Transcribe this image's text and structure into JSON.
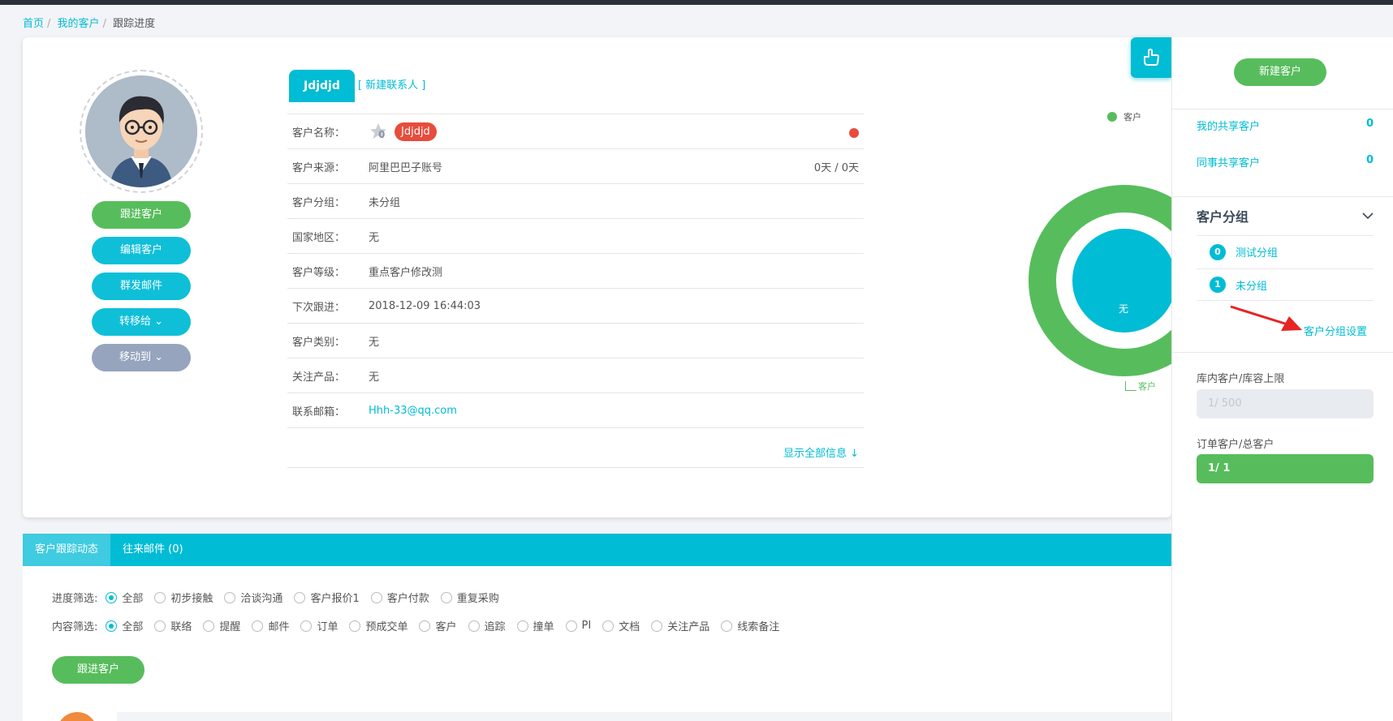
{
  "breadcrumb": {
    "home": "首页",
    "my_customers": "我的客户",
    "current": "跟踪进度"
  },
  "left_buttons": {
    "follow": "跟进客户",
    "edit": "编辑客户",
    "mass_mail": "群发邮件",
    "transfer": "转移给",
    "move": "移动到"
  },
  "contact_tab": {
    "name": "Jdjdjd",
    "new_contact": "[ 新建联系人 ]"
  },
  "info": {
    "customer_name_label": "客户名称：",
    "star_count": "0",
    "customer_name": "Jdjdjd",
    "source_label": "客户来源：",
    "source": "阿里巴巴子账号",
    "days": "0天 / 0天",
    "group_label": "客户分组：",
    "group": "未分组",
    "country_label": "国家地区：",
    "country": "无",
    "level_label": "客户等级：",
    "level": "重点客户修改测",
    "next_follow_label": "下次跟进：",
    "next_follow": "2018-12-09 16:44:03",
    "category_label": "客户类别：",
    "category": "无",
    "product_label": "关注产品：",
    "product": "无",
    "email_label": "联系邮箱：",
    "email": "Hhh-33@qq.com",
    "show_all": "显示全部信息 ↓"
  },
  "chart": {
    "legend": "客户",
    "center_label": "无",
    "ring_label": "客户",
    "colors": {
      "ring": "#57bd5c",
      "center": "#00bcd4"
    }
  },
  "tracking": {
    "tabs": [
      "客户跟踪动态",
      "往来邮件 (0)"
    ],
    "progress_label": "进度筛选:",
    "progress_options": [
      "全部",
      "初步接触",
      "洽谈沟通",
      "客户报价1",
      "客户付款",
      "重复采购"
    ],
    "content_label": "内容筛选:",
    "content_options": [
      "全部",
      "联络",
      "提醒",
      "邮件",
      "订单",
      "预成交单",
      "客户",
      "追踪",
      "撞单",
      "PI",
      "文档",
      "关注产品",
      "线索备注"
    ],
    "follow_button": "跟进客户"
  },
  "sidebar": {
    "new_customer": "新建客户",
    "my_shared": "我的共享客户",
    "my_shared_count": "0",
    "colleague_shared": "同事共享客户",
    "colleague_shared_count": "0",
    "group_title": "客户分组",
    "groups": [
      {
        "count": "0",
        "name": "测试分组"
      },
      {
        "count": "1",
        "name": "未分组"
      }
    ],
    "group_settings": "客户分组设置",
    "capacity_label": "库内客户/库容上限",
    "capacity_value": "1/ 500",
    "order_label": "订单客户/总客户",
    "order_value": "1/ 1"
  },
  "colors": {
    "accent": "#00bcd4",
    "green": "#57bd5c",
    "red": "#e74c3c",
    "muted": "#96a4bd"
  }
}
